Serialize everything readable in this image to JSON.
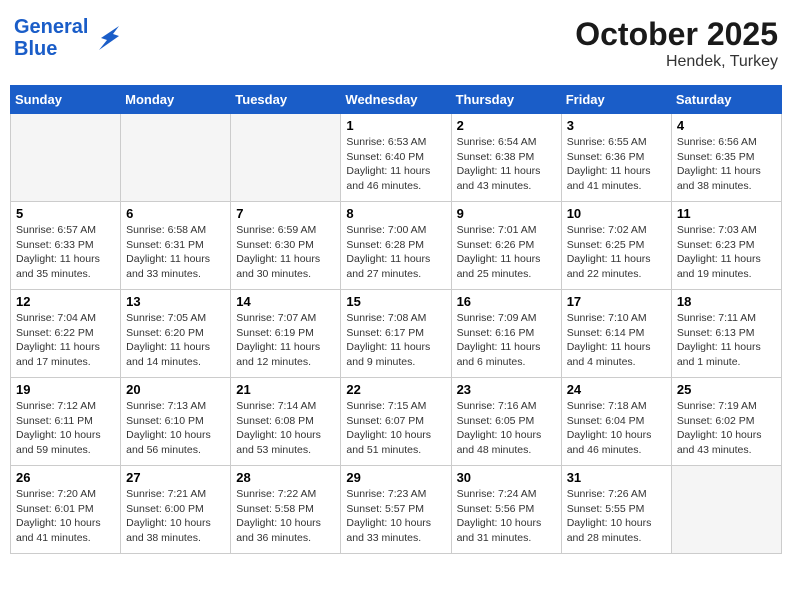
{
  "header": {
    "logo_line1": "General",
    "logo_line2": "Blue",
    "month": "October 2025",
    "location": "Hendek, Turkey"
  },
  "weekdays": [
    "Sunday",
    "Monday",
    "Tuesday",
    "Wednesday",
    "Thursday",
    "Friday",
    "Saturday"
  ],
  "weeks": [
    [
      {
        "day": "",
        "sunrise": "",
        "sunset": "",
        "daylight": ""
      },
      {
        "day": "",
        "sunrise": "",
        "sunset": "",
        "daylight": ""
      },
      {
        "day": "",
        "sunrise": "",
        "sunset": "",
        "daylight": ""
      },
      {
        "day": "1",
        "sunrise": "6:53 AM",
        "sunset": "6:40 PM",
        "daylight": "11 hours and 46 minutes."
      },
      {
        "day": "2",
        "sunrise": "6:54 AM",
        "sunset": "6:38 PM",
        "daylight": "11 hours and 43 minutes."
      },
      {
        "day": "3",
        "sunrise": "6:55 AM",
        "sunset": "6:36 PM",
        "daylight": "11 hours and 41 minutes."
      },
      {
        "day": "4",
        "sunrise": "6:56 AM",
        "sunset": "6:35 PM",
        "daylight": "11 hours and 38 minutes."
      }
    ],
    [
      {
        "day": "5",
        "sunrise": "6:57 AM",
        "sunset": "6:33 PM",
        "daylight": "11 hours and 35 minutes."
      },
      {
        "day": "6",
        "sunrise": "6:58 AM",
        "sunset": "6:31 PM",
        "daylight": "11 hours and 33 minutes."
      },
      {
        "day": "7",
        "sunrise": "6:59 AM",
        "sunset": "6:30 PM",
        "daylight": "11 hours and 30 minutes."
      },
      {
        "day": "8",
        "sunrise": "7:00 AM",
        "sunset": "6:28 PM",
        "daylight": "11 hours and 27 minutes."
      },
      {
        "day": "9",
        "sunrise": "7:01 AM",
        "sunset": "6:26 PM",
        "daylight": "11 hours and 25 minutes."
      },
      {
        "day": "10",
        "sunrise": "7:02 AM",
        "sunset": "6:25 PM",
        "daylight": "11 hours and 22 minutes."
      },
      {
        "day": "11",
        "sunrise": "7:03 AM",
        "sunset": "6:23 PM",
        "daylight": "11 hours and 19 minutes."
      }
    ],
    [
      {
        "day": "12",
        "sunrise": "7:04 AM",
        "sunset": "6:22 PM",
        "daylight": "11 hours and 17 minutes."
      },
      {
        "day": "13",
        "sunrise": "7:05 AM",
        "sunset": "6:20 PM",
        "daylight": "11 hours and 14 minutes."
      },
      {
        "day": "14",
        "sunrise": "7:07 AM",
        "sunset": "6:19 PM",
        "daylight": "11 hours and 12 minutes."
      },
      {
        "day": "15",
        "sunrise": "7:08 AM",
        "sunset": "6:17 PM",
        "daylight": "11 hours and 9 minutes."
      },
      {
        "day": "16",
        "sunrise": "7:09 AM",
        "sunset": "6:16 PM",
        "daylight": "11 hours and 6 minutes."
      },
      {
        "day": "17",
        "sunrise": "7:10 AM",
        "sunset": "6:14 PM",
        "daylight": "11 hours and 4 minutes."
      },
      {
        "day": "18",
        "sunrise": "7:11 AM",
        "sunset": "6:13 PM",
        "daylight": "11 hours and 1 minute."
      }
    ],
    [
      {
        "day": "19",
        "sunrise": "7:12 AM",
        "sunset": "6:11 PM",
        "daylight": "10 hours and 59 minutes."
      },
      {
        "day": "20",
        "sunrise": "7:13 AM",
        "sunset": "6:10 PM",
        "daylight": "10 hours and 56 minutes."
      },
      {
        "day": "21",
        "sunrise": "7:14 AM",
        "sunset": "6:08 PM",
        "daylight": "10 hours and 53 minutes."
      },
      {
        "day": "22",
        "sunrise": "7:15 AM",
        "sunset": "6:07 PM",
        "daylight": "10 hours and 51 minutes."
      },
      {
        "day": "23",
        "sunrise": "7:16 AM",
        "sunset": "6:05 PM",
        "daylight": "10 hours and 48 minutes."
      },
      {
        "day": "24",
        "sunrise": "7:18 AM",
        "sunset": "6:04 PM",
        "daylight": "10 hours and 46 minutes."
      },
      {
        "day": "25",
        "sunrise": "7:19 AM",
        "sunset": "6:02 PM",
        "daylight": "10 hours and 43 minutes."
      }
    ],
    [
      {
        "day": "26",
        "sunrise": "7:20 AM",
        "sunset": "6:01 PM",
        "daylight": "10 hours and 41 minutes."
      },
      {
        "day": "27",
        "sunrise": "7:21 AM",
        "sunset": "6:00 PM",
        "daylight": "10 hours and 38 minutes."
      },
      {
        "day": "28",
        "sunrise": "7:22 AM",
        "sunset": "5:58 PM",
        "daylight": "10 hours and 36 minutes."
      },
      {
        "day": "29",
        "sunrise": "7:23 AM",
        "sunset": "5:57 PM",
        "daylight": "10 hours and 33 minutes."
      },
      {
        "day": "30",
        "sunrise": "7:24 AM",
        "sunset": "5:56 PM",
        "daylight": "10 hours and 31 minutes."
      },
      {
        "day": "31",
        "sunrise": "7:26 AM",
        "sunset": "5:55 PM",
        "daylight": "10 hours and 28 minutes."
      },
      {
        "day": "",
        "sunrise": "",
        "sunset": "",
        "daylight": ""
      }
    ]
  ]
}
